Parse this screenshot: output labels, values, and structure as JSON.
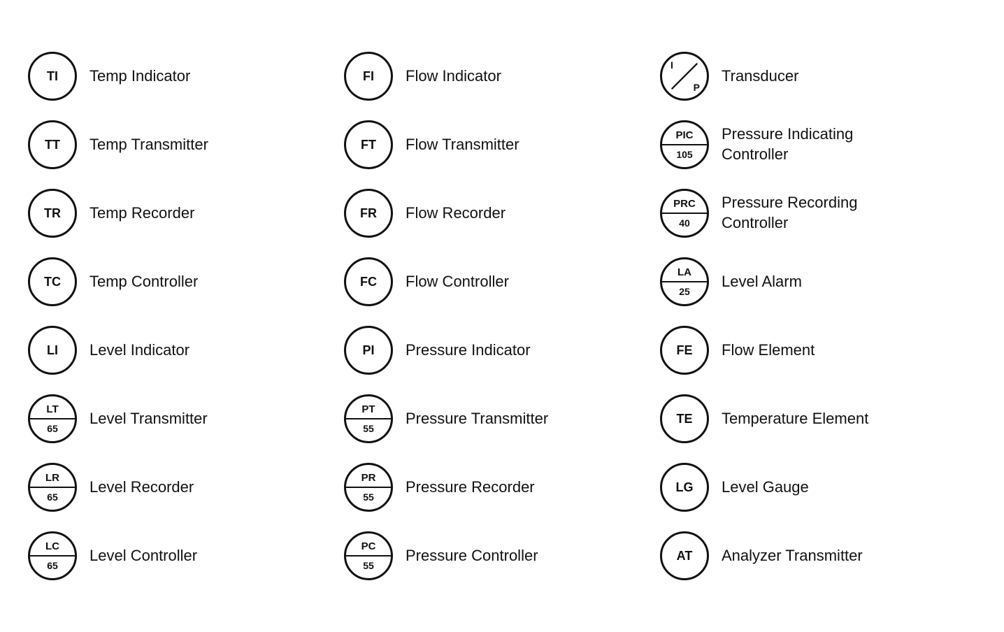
{
  "columns": [
    {
      "id": "col1",
      "rows": [
        {
          "id": "TI",
          "type": "simple",
          "top": "TI",
          "bottom": "",
          "label": "Temp Indicator"
        },
        {
          "id": "TT",
          "type": "simple",
          "top": "TT",
          "bottom": "",
          "label": "Temp Transmitter"
        },
        {
          "id": "TR",
          "type": "simple",
          "top": "TR",
          "bottom": "",
          "label": "Temp Recorder"
        },
        {
          "id": "TC",
          "type": "simple",
          "top": "TC",
          "bottom": "",
          "label": "Temp Controller"
        },
        {
          "id": "LI",
          "type": "simple",
          "top": "LI",
          "bottom": "",
          "label": "Level Indicator"
        },
        {
          "id": "LT",
          "type": "divided",
          "top": "LT",
          "bottom": "65",
          "label": "Level Transmitter"
        },
        {
          "id": "LR",
          "type": "divided",
          "top": "LR",
          "bottom": "65",
          "label": "Level Recorder"
        },
        {
          "id": "LC",
          "type": "divided",
          "top": "LC",
          "bottom": "65",
          "label": "Level Controller"
        }
      ]
    },
    {
      "id": "col2",
      "rows": [
        {
          "id": "FI",
          "type": "simple",
          "top": "FI",
          "bottom": "",
          "label": "Flow Indicator"
        },
        {
          "id": "FT",
          "type": "simple",
          "top": "FT",
          "bottom": "",
          "label": "Flow Transmitter"
        },
        {
          "id": "FR",
          "type": "simple",
          "top": "FR",
          "bottom": "",
          "label": "Flow Recorder"
        },
        {
          "id": "FC",
          "type": "simple",
          "top": "FC",
          "bottom": "",
          "label": "Flow Controller"
        },
        {
          "id": "PI",
          "type": "simple",
          "top": "PI",
          "bottom": "",
          "label": "Pressure Indicator"
        },
        {
          "id": "PT",
          "type": "divided",
          "top": "PT",
          "bottom": "55",
          "label": "Pressure Transmitter"
        },
        {
          "id": "PR",
          "type": "divided",
          "top": "PR",
          "bottom": "55",
          "label": "Pressure Recorder"
        },
        {
          "id": "PC",
          "type": "divided",
          "top": "PC",
          "bottom": "55",
          "label": "Pressure Controller"
        }
      ]
    },
    {
      "id": "col3",
      "rows": [
        {
          "id": "TRANS",
          "type": "diagonal",
          "top": "I",
          "bottom": "P",
          "label": "Transducer"
        },
        {
          "id": "PIC",
          "type": "divided",
          "top": "PIC",
          "bottom": "105",
          "label": "Pressure Indicating\nController"
        },
        {
          "id": "PRC",
          "type": "divided",
          "top": "PRC",
          "bottom": "40",
          "label": "Pressure Recording\nController"
        },
        {
          "id": "LA",
          "type": "divided",
          "top": "LA",
          "bottom": "25",
          "label": "Level Alarm"
        },
        {
          "id": "FE",
          "type": "simple",
          "top": "FE",
          "bottom": "",
          "label": "Flow Element"
        },
        {
          "id": "TE",
          "type": "simple",
          "top": "TE",
          "bottom": "",
          "label": "Temperature Element"
        },
        {
          "id": "LG",
          "type": "simple",
          "top": "LG",
          "bottom": "",
          "label": "Level Gauge"
        },
        {
          "id": "AT",
          "type": "simple",
          "top": "AT",
          "bottom": "",
          "label": "Analyzer Transmitter"
        }
      ]
    }
  ]
}
